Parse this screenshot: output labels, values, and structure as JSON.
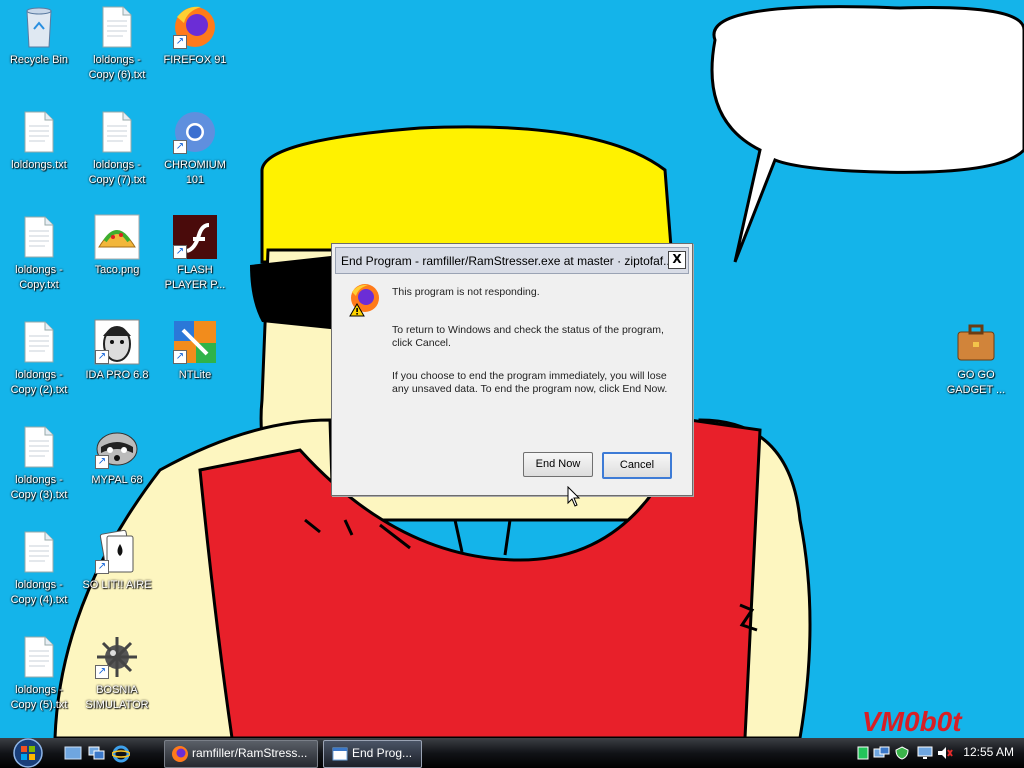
{
  "desktop": {
    "icons": [
      {
        "label": "Recycle Bin",
        "icon": "recycle-bin-icon"
      },
      {
        "label": "loldongs - Copy (6).txt",
        "icon": "text-file-icon"
      },
      {
        "label": "FIREFOX 91",
        "icon": "firefox-icon"
      },
      {
        "label": "loldongs.txt",
        "icon": "text-file-icon"
      },
      {
        "label": "loldongs - Copy (7).txt",
        "icon": "text-file-icon"
      },
      {
        "label": "CHROMIUM 101",
        "icon": "chromium-icon"
      },
      {
        "label": "loldongs - Copy.txt",
        "icon": "text-file-icon"
      },
      {
        "label": "Taco.png",
        "icon": "taco-icon"
      },
      {
        "label": "FLASH PLAYER P...",
        "icon": "flash-player-icon"
      },
      {
        "label": "loldongs - Copy (2).txt",
        "icon": "text-file-icon"
      },
      {
        "label": "IDA PRO 6.8",
        "icon": "ida-pro-icon"
      },
      {
        "label": "NTLite",
        "icon": "ntlite-icon"
      },
      {
        "label": "loldongs - Copy (3).txt",
        "icon": "text-file-icon"
      },
      {
        "label": "MYPAL 68",
        "icon": "mypal-icon"
      },
      {
        "label": "loldongs - Copy (4).txt",
        "icon": "text-file-icon"
      },
      {
        "label": "SO LIT!! AIRE",
        "icon": "solitaire-icon"
      },
      {
        "label": "loldongs - Copy (5).txt",
        "icon": "text-file-icon"
      },
      {
        "label": "BOSNIA SIMULATOR",
        "icon": "minesweeper-icon"
      },
      {
        "label": "GO GO GADGET ...",
        "icon": "briefcase-icon"
      }
    ],
    "wallpaper": {
      "signature": "VM0b0t"
    }
  },
  "dialog": {
    "title": "End Program - ramfiller/RamStresser.exe at master · ziptofaf...",
    "close_label": "X",
    "line1": "This program is not responding.",
    "line2": "To return to Windows and check the status of the program, click Cancel.",
    "line3": "If you choose to end the program immediately, you will lose any unsaved data. To end the program now, click End Now.",
    "end_now": "End Now",
    "cancel": "Cancel"
  },
  "taskbar": {
    "tasks": [
      {
        "label": "ramfiller/RamStress...",
        "icon": "firefox-icon"
      },
      {
        "label": "End Prog...",
        "icon": "window-icon"
      }
    ],
    "clock": "12:55 AM"
  }
}
